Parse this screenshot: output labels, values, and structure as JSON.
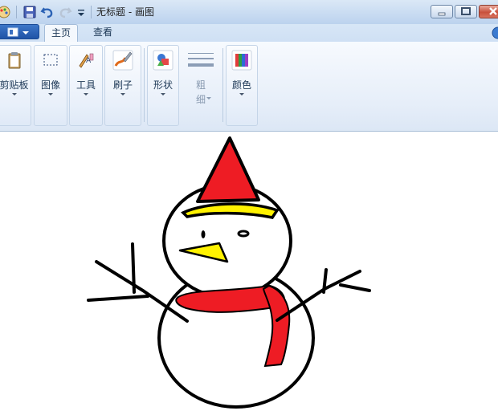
{
  "window": {
    "title": "无标题 - 画图",
    "controls": [
      "minimize-icon",
      "maximize-icon",
      "close-icon"
    ]
  },
  "quick_access": [
    "paint-app-icon",
    "save-icon",
    "undo-icon",
    "redo-icon",
    "customize-dropdown-icon"
  ],
  "tabs": [
    {
      "label": "主页",
      "active": true
    },
    {
      "label": "查看",
      "active": false
    }
  ],
  "ribbon": {
    "groups": [
      {
        "label": "剪贴板",
        "icon": "clipboard-icon"
      },
      {
        "label": "图像",
        "icon": "select-icon"
      },
      {
        "label": "工具",
        "icon": "tools-icon"
      },
      {
        "label": "刷子",
        "icon": "brush-icon"
      },
      {
        "label": "形状",
        "icon": "shapes-icon"
      },
      {
        "label_line1": "粗",
        "label_line2": "细",
        "icon": "line-size-icon",
        "disabled": true
      },
      {
        "label": "颜色",
        "icon": "color-palette-icon"
      }
    ]
  },
  "canvas": {
    "drawing": "snowman",
    "colors": {
      "outline": "#000000",
      "hat": "#ee1c24",
      "hat_band": "#fff200",
      "nose": "#fff200",
      "scarf": "#ee1c24",
      "background": "#ffffff"
    }
  }
}
